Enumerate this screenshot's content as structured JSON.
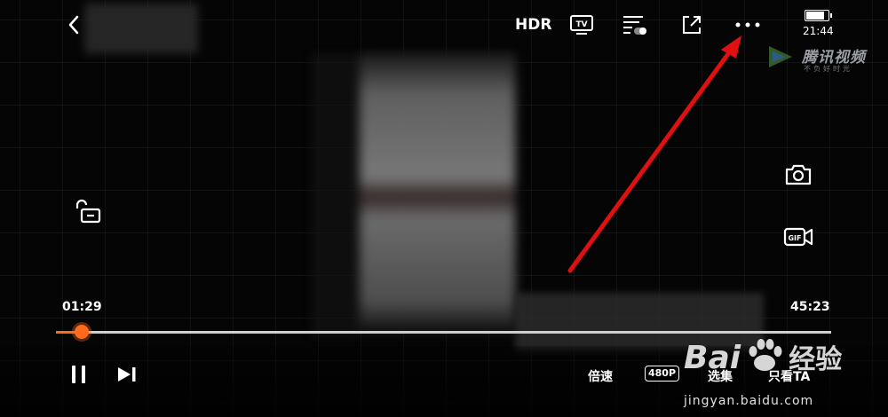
{
  "top_bar": {
    "hdr_label": "HDR",
    "tv_label": "TV",
    "time": "21:44"
  },
  "battery": {
    "level": 0.85
  },
  "brand": {
    "name": "腾讯视频",
    "slogan": "不负好时光"
  },
  "player": {
    "elapsed": "01:29",
    "duration": "45:23",
    "progress": 0.033,
    "speed_label": "倍速",
    "quality_label": "480P",
    "episodes_label": "选集",
    "only_ta_label": "只看TA",
    "gif_label": "GIF"
  },
  "watermark": {
    "logo_text": "Bai",
    "logo_text2": "经验",
    "url": "jingyan.baidu.com"
  },
  "annotation": {
    "arrow_color": "#e01010"
  },
  "colors": {
    "accent": "#ff6b1a"
  }
}
